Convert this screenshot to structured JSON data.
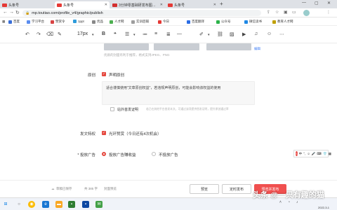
{
  "browser": {
    "tabs": [
      {
        "title": "头条号",
        "active": false
      },
      {
        "title": "头条号",
        "active": true
      },
      {
        "title": "3分钟零基础研发布图文…",
        "active": false
      },
      {
        "title": "头条号",
        "active": false
      }
    ],
    "url": "mp.toutiao.com/profile_v4/graphic/publish",
    "bookmarks": [
      {
        "label": "百度",
        "color": "#3a6fd8"
      },
      {
        "label": "学习平台",
        "color": "#5b8def"
      },
      {
        "label": "赞赏令",
        "color": "#d84343"
      },
      {
        "label": "1ppt",
        "color": "#2d9cdb"
      },
      {
        "label": "优品",
        "color": "#888"
      },
      {
        "label": "人才网",
        "color": "#4caf50"
      },
      {
        "label": "实训后辅",
        "color": "#9e9e9e"
      },
      {
        "label": "今日",
        "color": "#e53935"
      },
      {
        "label": "百度翻译",
        "color": "#2b6de5"
      },
      {
        "label": "公众号",
        "color": "#2cb34a"
      },
      {
        "label": "微信读书",
        "color": "#1e88e5"
      },
      {
        "label": "教育人才网",
        "color": "#c0a000"
      }
    ]
  },
  "toolbar": {
    "font_size": "17px"
  },
  "cover": {
    "tip": "优质的封面有利于推荐，格式支持JPEG、PNG",
    "link": "编辑"
  },
  "declare": {
    "label": "原创",
    "checkbox_label": "声明原创",
    "hint": "适合谨慎使用“文章原创权益”，若违规声明原创，可能会影响该权益的使用",
    "exclusive_label": "站外首发证明",
    "exclusive_tip": "若已在其他平台首发本文，可通过该项提供首发证明，提升原创通过率"
  },
  "rights": {
    "label": "发文特权",
    "checkbox_label": "光环赞赏（今日还有4次机会）"
  },
  "ad": {
    "label": "* 投放广告",
    "option_on": "投放广告赚收益",
    "option_off": "不投放广告"
  },
  "floating": {
    "logo": "S",
    "label": "中"
  },
  "actions": {
    "draft_status": "草稿已保存",
    "word_count": "共 385 字",
    "cover_preview": "封面预览",
    "preview": "预览",
    "schedule": "定时发布",
    "publish": "预览并发布"
  },
  "taskbar": {
    "watermark": "头条 @一只有趣的猫",
    "time_text": "2022-3-1"
  },
  "colors": {
    "accent": "#e5483f",
    "primary_button": "#f0504f",
    "link": "#3d7cf5"
  }
}
